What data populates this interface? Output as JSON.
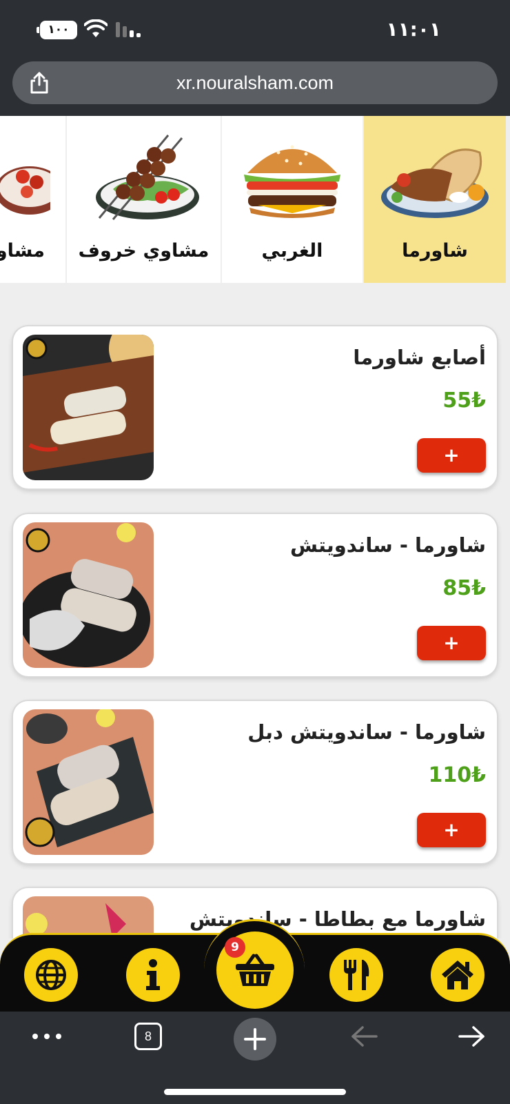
{
  "status_bar": {
    "battery": "١٠٠",
    "time": "١١:٠١"
  },
  "browser": {
    "url": "xr.nouralsham.com",
    "tabs_count": "8"
  },
  "categories": [
    {
      "label": "شاورما",
      "active": true
    },
    {
      "label": "الغربي",
      "active": false
    },
    {
      "label": "مشاوي خروف",
      "active": false
    },
    {
      "label": "مشاوي",
      "active": false
    }
  ],
  "products": [
    {
      "name": "أصابع شاورما",
      "price": "55₺",
      "add_label": "+"
    },
    {
      "name": "شاورما - ساندويتش",
      "price": "85₺",
      "add_label": "+"
    },
    {
      "name": "شاورما - ساندويتش دبل",
      "price": "110₺",
      "add_label": "+"
    },
    {
      "name": "شاورما مع بطاطا - ساندويتش",
      "price": "",
      "add_label": "+"
    }
  ],
  "nav": {
    "cart_count": "9"
  },
  "colors": {
    "accent": "#f9d00f",
    "add_button": "#e02a0c",
    "price": "#4ea01a",
    "active_category": "#f7e28e"
  }
}
